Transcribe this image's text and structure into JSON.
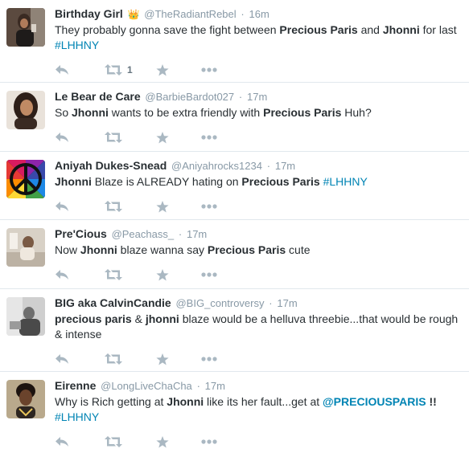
{
  "tweets": [
    {
      "name": "Birthday Girl",
      "badge": "👑",
      "handle": "@TheRadiantRebel",
      "time": "16m",
      "text": [
        {
          "t": "They probably gonna save the fight between ",
          "s": "plain"
        },
        {
          "t": "Precious Paris",
          "s": "bold"
        },
        {
          "t": " and ",
          "s": "plain"
        },
        {
          "t": "Jhonni",
          "s": "bold"
        },
        {
          "t": " for last ",
          "s": "plain"
        },
        {
          "t": "#LHHNY",
          "s": "tag"
        }
      ],
      "retweet_count": "1"
    },
    {
      "name": "Le Bear de Care",
      "handle": "@BarbieBardot027",
      "time": "17m",
      "text": [
        {
          "t": "So ",
          "s": "plain"
        },
        {
          "t": "Jhonni",
          "s": "bold"
        },
        {
          "t": " wants to be extra friendly with ",
          "s": "plain"
        },
        {
          "t": "Precious Paris",
          "s": "bold"
        },
        {
          "t": " Huh?",
          "s": "plain"
        }
      ]
    },
    {
      "name": "Aniyah Dukes-Snead",
      "handle": "@Aniyahrocks1234",
      "time": "17m",
      "text": [
        {
          "t": "Jhonni",
          "s": "bold"
        },
        {
          "t": " Blaze is ALREADY hating on ",
          "s": "plain"
        },
        {
          "t": "Precious Paris",
          "s": "bold"
        },
        {
          "t": "  ",
          "s": "plain"
        },
        {
          "t": "#LHHNY",
          "s": "tag"
        }
      ]
    },
    {
      "name": "Pre'Cious",
      "handle": "@Peachass_",
      "time": "17m",
      "text": [
        {
          "t": "Now ",
          "s": "plain"
        },
        {
          "t": "Jhonni",
          "s": "bold"
        },
        {
          "t": " blaze wanna say ",
          "s": "plain"
        },
        {
          "t": "Precious Paris",
          "s": "bold"
        },
        {
          "t": " cute",
          "s": "plain"
        }
      ]
    },
    {
      "name": "BIG aka CalvinCandie",
      "handle": "@BIG_controversy",
      "time": "17m",
      "text": [
        {
          "t": "precious paris",
          "s": "bold"
        },
        {
          "t": " & ",
          "s": "plain"
        },
        {
          "t": "jhonni",
          "s": "bold"
        },
        {
          "t": " blaze would be a helluva threebie...that would be rough & intense",
          "s": "plain"
        }
      ]
    },
    {
      "name": "Eirenne",
      "handle": "@LongLiveChaCha",
      "time": "17m",
      "text": [
        {
          "t": "Why is Rich getting at ",
          "s": "plain"
        },
        {
          "t": "Jhonni",
          "s": "bold"
        },
        {
          "t": " like its her fault...get at ",
          "s": "plain"
        },
        {
          "t": "@PRECIOUSPARIS",
          "s": "mention"
        },
        {
          "t": " !! ",
          "s": "bold"
        },
        {
          "t": "#LHHNY",
          "s": "tag"
        }
      ]
    }
  ],
  "icons": {
    "reply": "reply-icon",
    "retweet": "retweet-icon",
    "favorite": "star-icon",
    "more": "more-icon"
  },
  "colors": {
    "name": "#292f33",
    "meta": "#8899a6",
    "link": "#0084b4",
    "action": "#aab8c2",
    "divider": "#e1e8ed"
  }
}
